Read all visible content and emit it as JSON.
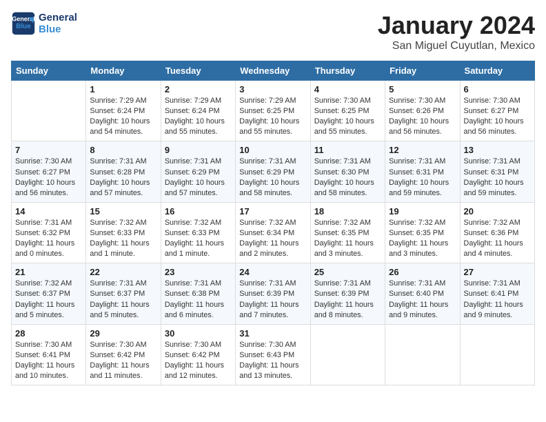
{
  "header": {
    "logo_line1": "General",
    "logo_line2": "Blue",
    "title": "January 2024",
    "subtitle": "San Miguel Cuyutlan, Mexico"
  },
  "columns": [
    "Sunday",
    "Monday",
    "Tuesday",
    "Wednesday",
    "Thursday",
    "Friday",
    "Saturday"
  ],
  "weeks": [
    [
      {
        "day": "",
        "info": ""
      },
      {
        "day": "1",
        "info": "Sunrise: 7:29 AM\nSunset: 6:24 PM\nDaylight: 10 hours\nand 54 minutes."
      },
      {
        "day": "2",
        "info": "Sunrise: 7:29 AM\nSunset: 6:24 PM\nDaylight: 10 hours\nand 55 minutes."
      },
      {
        "day": "3",
        "info": "Sunrise: 7:29 AM\nSunset: 6:25 PM\nDaylight: 10 hours\nand 55 minutes."
      },
      {
        "day": "4",
        "info": "Sunrise: 7:30 AM\nSunset: 6:25 PM\nDaylight: 10 hours\nand 55 minutes."
      },
      {
        "day": "5",
        "info": "Sunrise: 7:30 AM\nSunset: 6:26 PM\nDaylight: 10 hours\nand 56 minutes."
      },
      {
        "day": "6",
        "info": "Sunrise: 7:30 AM\nSunset: 6:27 PM\nDaylight: 10 hours\nand 56 minutes."
      }
    ],
    [
      {
        "day": "7",
        "info": "Sunrise: 7:30 AM\nSunset: 6:27 PM\nDaylight: 10 hours\nand 56 minutes."
      },
      {
        "day": "8",
        "info": "Sunrise: 7:31 AM\nSunset: 6:28 PM\nDaylight: 10 hours\nand 57 minutes."
      },
      {
        "day": "9",
        "info": "Sunrise: 7:31 AM\nSunset: 6:29 PM\nDaylight: 10 hours\nand 57 minutes."
      },
      {
        "day": "10",
        "info": "Sunrise: 7:31 AM\nSunset: 6:29 PM\nDaylight: 10 hours\nand 58 minutes."
      },
      {
        "day": "11",
        "info": "Sunrise: 7:31 AM\nSunset: 6:30 PM\nDaylight: 10 hours\nand 58 minutes."
      },
      {
        "day": "12",
        "info": "Sunrise: 7:31 AM\nSunset: 6:31 PM\nDaylight: 10 hours\nand 59 minutes."
      },
      {
        "day": "13",
        "info": "Sunrise: 7:31 AM\nSunset: 6:31 PM\nDaylight: 10 hours\nand 59 minutes."
      }
    ],
    [
      {
        "day": "14",
        "info": "Sunrise: 7:31 AM\nSunset: 6:32 PM\nDaylight: 11 hours\nand 0 minutes."
      },
      {
        "day": "15",
        "info": "Sunrise: 7:32 AM\nSunset: 6:33 PM\nDaylight: 11 hours\nand 1 minute."
      },
      {
        "day": "16",
        "info": "Sunrise: 7:32 AM\nSunset: 6:33 PM\nDaylight: 11 hours\nand 1 minute."
      },
      {
        "day": "17",
        "info": "Sunrise: 7:32 AM\nSunset: 6:34 PM\nDaylight: 11 hours\nand 2 minutes."
      },
      {
        "day": "18",
        "info": "Sunrise: 7:32 AM\nSunset: 6:35 PM\nDaylight: 11 hours\nand 3 minutes."
      },
      {
        "day": "19",
        "info": "Sunrise: 7:32 AM\nSunset: 6:35 PM\nDaylight: 11 hours\nand 3 minutes."
      },
      {
        "day": "20",
        "info": "Sunrise: 7:32 AM\nSunset: 6:36 PM\nDaylight: 11 hours\nand 4 minutes."
      }
    ],
    [
      {
        "day": "21",
        "info": "Sunrise: 7:32 AM\nSunset: 6:37 PM\nDaylight: 11 hours\nand 5 minutes."
      },
      {
        "day": "22",
        "info": "Sunrise: 7:31 AM\nSunset: 6:37 PM\nDaylight: 11 hours\nand 5 minutes."
      },
      {
        "day": "23",
        "info": "Sunrise: 7:31 AM\nSunset: 6:38 PM\nDaylight: 11 hours\nand 6 minutes."
      },
      {
        "day": "24",
        "info": "Sunrise: 7:31 AM\nSunset: 6:39 PM\nDaylight: 11 hours\nand 7 minutes."
      },
      {
        "day": "25",
        "info": "Sunrise: 7:31 AM\nSunset: 6:39 PM\nDaylight: 11 hours\nand 8 minutes."
      },
      {
        "day": "26",
        "info": "Sunrise: 7:31 AM\nSunset: 6:40 PM\nDaylight: 11 hours\nand 9 minutes."
      },
      {
        "day": "27",
        "info": "Sunrise: 7:31 AM\nSunset: 6:41 PM\nDaylight: 11 hours\nand 9 minutes."
      }
    ],
    [
      {
        "day": "28",
        "info": "Sunrise: 7:30 AM\nSunset: 6:41 PM\nDaylight: 11 hours\nand 10 minutes."
      },
      {
        "day": "29",
        "info": "Sunrise: 7:30 AM\nSunset: 6:42 PM\nDaylight: 11 hours\nand 11 minutes."
      },
      {
        "day": "30",
        "info": "Sunrise: 7:30 AM\nSunset: 6:42 PM\nDaylight: 11 hours\nand 12 minutes."
      },
      {
        "day": "31",
        "info": "Sunrise: 7:30 AM\nSunset: 6:43 PM\nDaylight: 11 hours\nand 13 minutes."
      },
      {
        "day": "",
        "info": ""
      },
      {
        "day": "",
        "info": ""
      },
      {
        "day": "",
        "info": ""
      }
    ]
  ]
}
